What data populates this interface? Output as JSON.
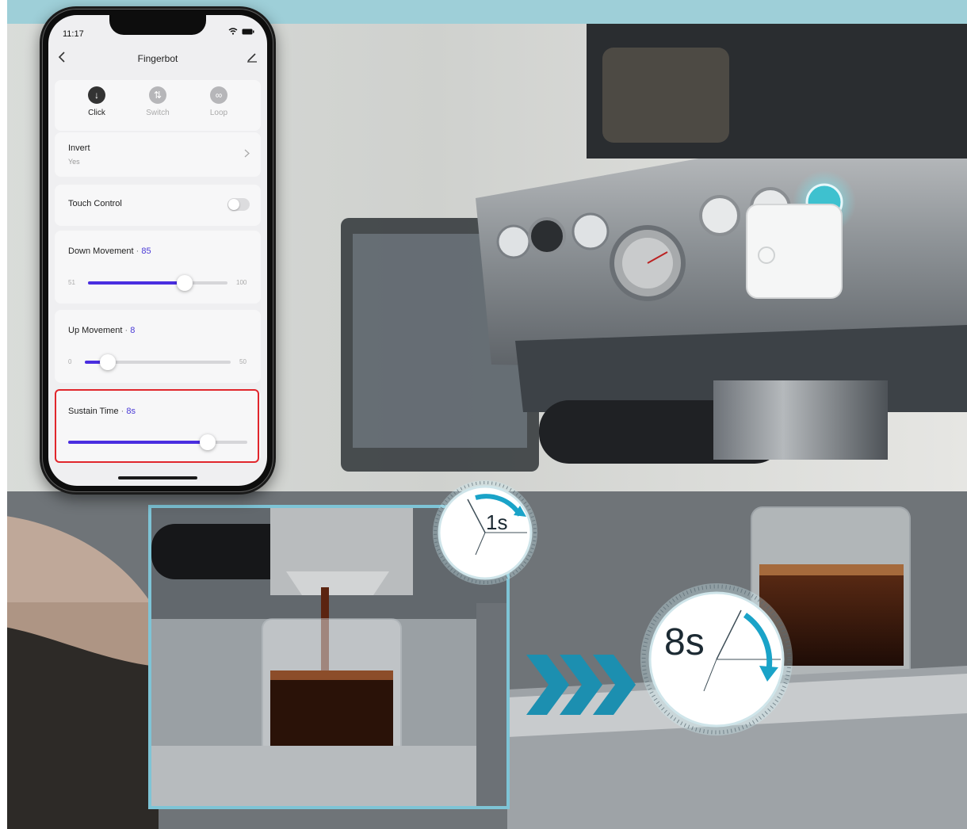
{
  "status_bar": {
    "time": "11:17",
    "icons": "▾ ▬"
  },
  "nav": {
    "title": "Fingerbot",
    "back_icon": "chevron-left-icon",
    "edit_icon": "edit-icon"
  },
  "modes": [
    {
      "label": "Click",
      "icon": "arrow-down-icon",
      "active": true
    },
    {
      "label": "Switch",
      "icon": "switch-arrows-icon",
      "active": false
    },
    {
      "label": "Loop",
      "icon": "link-icon",
      "active": false
    }
  ],
  "invert": {
    "label": "Invert",
    "value": "Yes"
  },
  "touch_control": {
    "label": "Touch Control",
    "enabled": false
  },
  "down_movement": {
    "label": "Down Movement",
    "separator": "·",
    "value": "85",
    "min": "51",
    "max": "100",
    "level": 85
  },
  "up_movement": {
    "label": "Up Movement",
    "separator": "·",
    "value": "8",
    "min": "0",
    "max": "50",
    "level": 8
  },
  "sustain_time": {
    "label": "Sustain Time",
    "separator": "·",
    "value": "8s",
    "fraction": 0.78
  },
  "timers": {
    "before": "1s",
    "after": "8s"
  },
  "colors": {
    "accent": "#4a2ee0",
    "highlight_border": "#e1262c",
    "frame": "#7ec4d6",
    "arrows": "#1c8fb0"
  }
}
